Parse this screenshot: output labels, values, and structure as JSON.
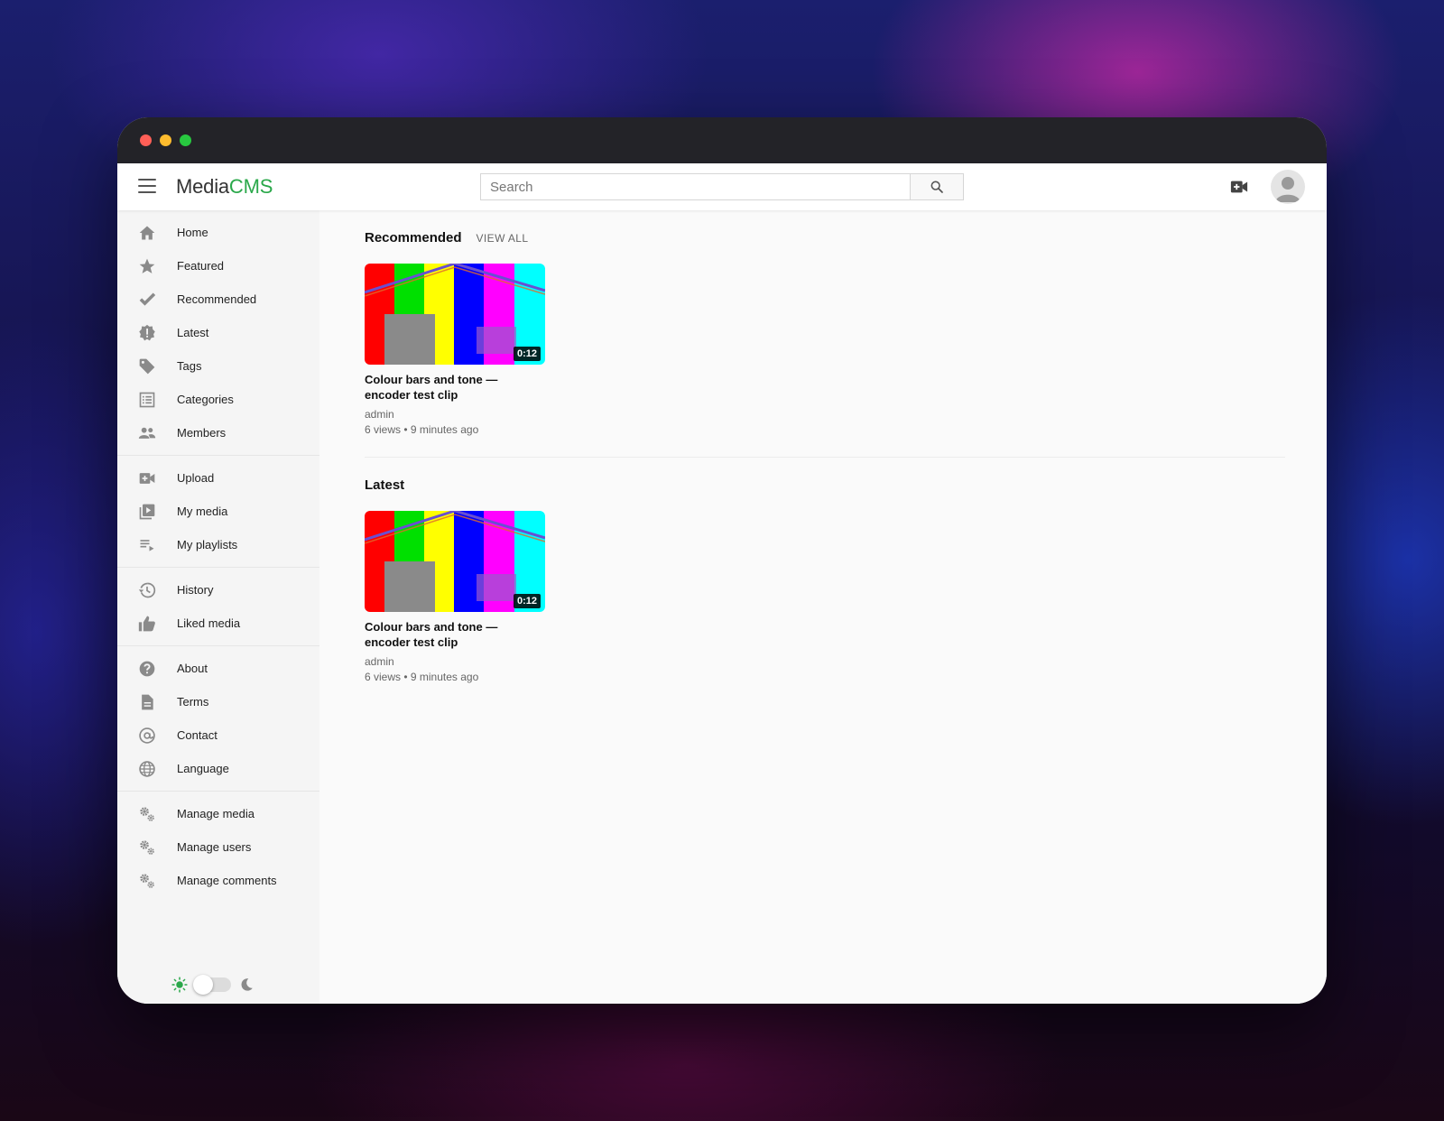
{
  "app": {
    "logo_media": "Media",
    "logo_cms": "CMS"
  },
  "search": {
    "placeholder": "Search"
  },
  "sidebar": {
    "groups": [
      [
        {
          "label": "Home",
          "icon": "home-icon"
        },
        {
          "label": "Featured",
          "icon": "star-icon"
        },
        {
          "label": "Recommended",
          "icon": "checkmark-icon"
        },
        {
          "label": "Latest",
          "icon": "new-releases-icon"
        },
        {
          "label": "Tags",
          "icon": "tag-icon"
        },
        {
          "label": "Categories",
          "icon": "list-icon"
        },
        {
          "label": "Members",
          "icon": "people-icon"
        }
      ],
      [
        {
          "label": "Upload",
          "icon": "video-add-icon"
        },
        {
          "label": "My media",
          "icon": "video-library-icon"
        },
        {
          "label": "My playlists",
          "icon": "playlist-icon"
        }
      ],
      [
        {
          "label": "History",
          "icon": "history-icon"
        },
        {
          "label": "Liked media",
          "icon": "thumb-up-icon"
        }
      ],
      [
        {
          "label": "About",
          "icon": "help-icon"
        },
        {
          "label": "Terms",
          "icon": "document-icon"
        },
        {
          "label": "Contact",
          "icon": "at-sign-icon"
        },
        {
          "label": "Language",
          "icon": "globe-icon"
        }
      ],
      [
        {
          "label": "Manage media",
          "icon": "gears-icon"
        },
        {
          "label": "Manage users",
          "icon": "gears-icon"
        },
        {
          "label": "Manage comments",
          "icon": "gears-icon"
        }
      ]
    ]
  },
  "sections": [
    {
      "title": "Recommended",
      "view_all": "VIEW ALL",
      "items": [
        {
          "title": "Colour bars and tone — encoder test clip",
          "author": "admin",
          "meta": "6 views • 9 minutes ago",
          "duration": "0:12"
        }
      ]
    },
    {
      "title": "Latest",
      "view_all": "",
      "items": [
        {
          "title": "Colour bars and tone — encoder test clip",
          "author": "admin",
          "meta": "6 views • 9 minutes ago",
          "duration": "0:12"
        }
      ]
    }
  ],
  "colors": {
    "accent": "#2aa84a",
    "titlebar": "#232328",
    "sidebar_bg": "#f5f5f5",
    "icon_gray": "#8a8a8a"
  }
}
